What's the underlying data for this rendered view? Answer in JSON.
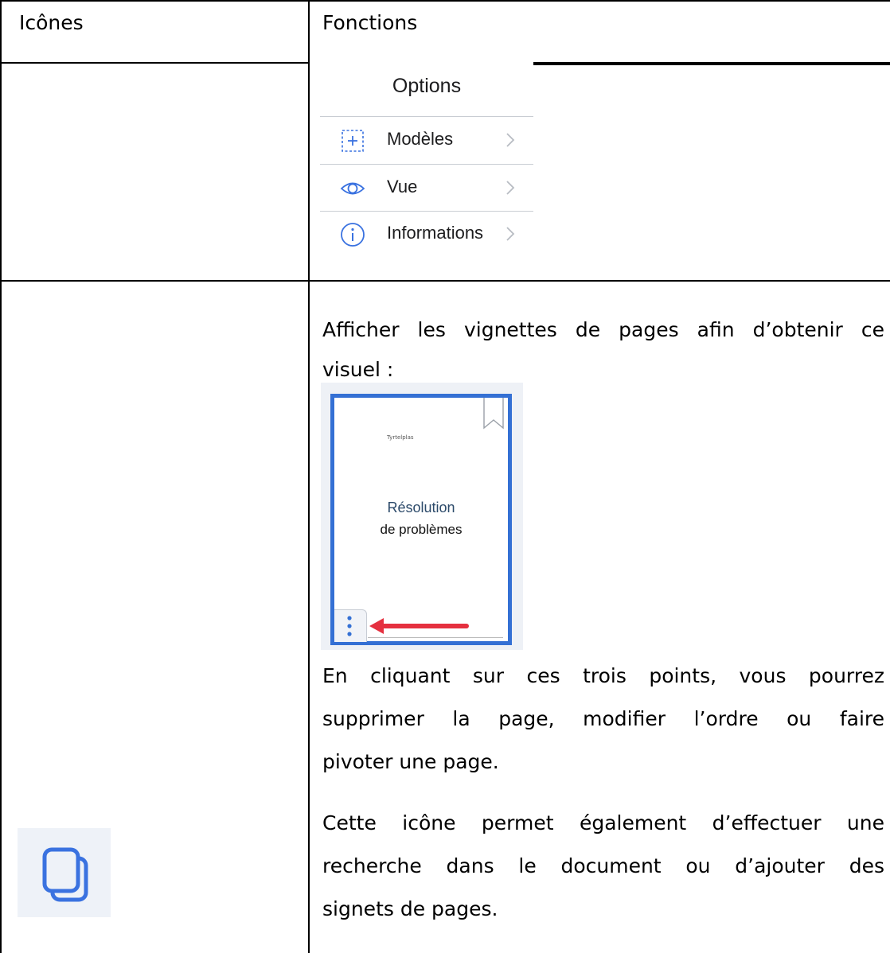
{
  "table": {
    "col1_header": "Icônes",
    "col2_header": "Fonctions"
  },
  "options_panel": {
    "title": "Options",
    "items": [
      {
        "label": "Modèles",
        "icon": "add-template-icon"
      },
      {
        "label": "Vue",
        "icon": "eye-icon"
      },
      {
        "label": "Informations",
        "icon": "info-icon"
      }
    ]
  },
  "thumbnails_row": {
    "icon": "pages-copy-icon",
    "intro_lines": [
      "Afficher les vignettes de pages afin d’obtenir ce",
      "visuel :"
    ],
    "thumbnail": {
      "small_text": "Tyrtelplas",
      "title_line1": "Résolution",
      "title_line2": "de problèmes"
    },
    "para1_lines": [
      "En cliquant sur ces trois points, vous pourrez",
      "supprimer la page, modifier l’ordre ou faire",
      "pivoter une page."
    ],
    "para2_lines": [
      "Cette icône permet également d’effectuer une",
      "recherche dans le document ou d’ajouter des",
      "signets de pages."
    ]
  },
  "colors": {
    "accent_blue": "#3470d4",
    "arrow_red": "#e5303f",
    "icon_blue": "#3a72e0"
  }
}
